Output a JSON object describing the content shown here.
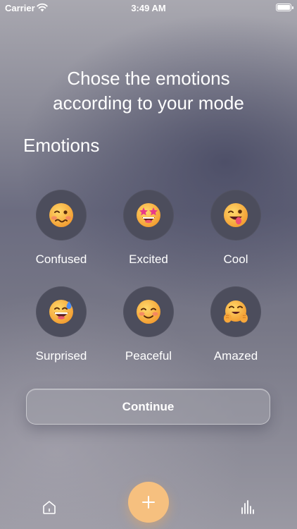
{
  "status_bar": {
    "carrier": "Carrier",
    "time": "3:49 AM"
  },
  "headline": {
    "line1": "Chose the emotions",
    "line2": "according to your mode"
  },
  "section_title": "Emotions",
  "emotions": [
    {
      "label": "Confused",
      "icon": "woozy-face-icon"
    },
    {
      "label": "Excited",
      "icon": "star-struck-face-icon"
    },
    {
      "label": "Cool",
      "icon": "winking-tongue-face-icon"
    },
    {
      "label": "Surprised",
      "icon": "grinning-sweat-face-icon"
    },
    {
      "label": "Peaceful",
      "icon": "smiling-face-icon"
    },
    {
      "label": "Amazed",
      "icon": "hugging-face-icon"
    }
  ],
  "continue_label": "Continue",
  "tab_bar": {
    "left_icon": "home-icon",
    "center_icon": "plus-icon",
    "right_icon": "bar-chart-icon"
  },
  "colors": {
    "accent": "#f6c07f",
    "emotion_circle": "#4c4d5c",
    "face": "#f7b532"
  }
}
